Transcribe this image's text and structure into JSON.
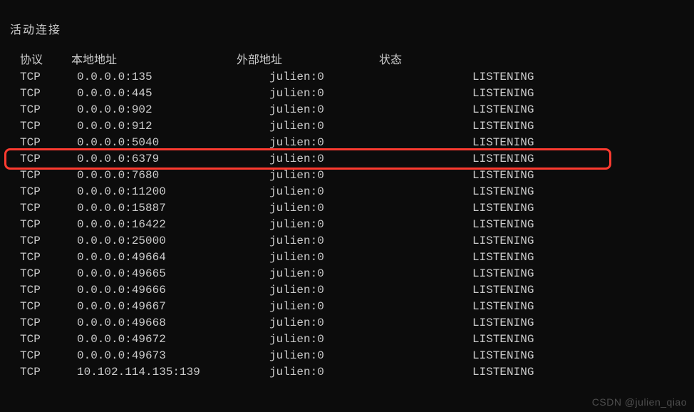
{
  "title": "活动连接",
  "headers": {
    "proto": "协议",
    "local": "本地地址",
    "foreign": "外部地址",
    "state": "状态"
  },
  "rows": [
    {
      "proto": "TCP",
      "local": "0.0.0.0:135",
      "foreign": "julien:0",
      "state": "LISTENING"
    },
    {
      "proto": "TCP",
      "local": "0.0.0.0:445",
      "foreign": "julien:0",
      "state": "LISTENING"
    },
    {
      "proto": "TCP",
      "local": "0.0.0.0:902",
      "foreign": "julien:0",
      "state": "LISTENING"
    },
    {
      "proto": "TCP",
      "local": "0.0.0.0:912",
      "foreign": "julien:0",
      "state": "LISTENING"
    },
    {
      "proto": "TCP",
      "local": "0.0.0.0:5040",
      "foreign": "julien:0",
      "state": "LISTENING"
    },
    {
      "proto": "TCP",
      "local": "0.0.0.0:6379",
      "foreign": "julien:0",
      "state": "LISTENING"
    },
    {
      "proto": "TCP",
      "local": "0.0.0.0:7680",
      "foreign": "julien:0",
      "state": "LISTENING"
    },
    {
      "proto": "TCP",
      "local": "0.0.0.0:11200",
      "foreign": "julien:0",
      "state": "LISTENING"
    },
    {
      "proto": "TCP",
      "local": "0.0.0.0:15887",
      "foreign": "julien:0",
      "state": "LISTENING"
    },
    {
      "proto": "TCP",
      "local": "0.0.0.0:16422",
      "foreign": "julien:0",
      "state": "LISTENING"
    },
    {
      "proto": "TCP",
      "local": "0.0.0.0:25000",
      "foreign": "julien:0",
      "state": "LISTENING"
    },
    {
      "proto": "TCP",
      "local": "0.0.0.0:49664",
      "foreign": "julien:0",
      "state": "LISTENING"
    },
    {
      "proto": "TCP",
      "local": "0.0.0.0:49665",
      "foreign": "julien:0",
      "state": "LISTENING"
    },
    {
      "proto": "TCP",
      "local": "0.0.0.0:49666",
      "foreign": "julien:0",
      "state": "LISTENING"
    },
    {
      "proto": "TCP",
      "local": "0.0.0.0:49667",
      "foreign": "julien:0",
      "state": "LISTENING"
    },
    {
      "proto": "TCP",
      "local": "0.0.0.0:49668",
      "foreign": "julien:0",
      "state": "LISTENING"
    },
    {
      "proto": "TCP",
      "local": "0.0.0.0:49672",
      "foreign": "julien:0",
      "state": "LISTENING"
    },
    {
      "proto": "TCP",
      "local": "0.0.0.0:49673",
      "foreign": "julien:0",
      "state": "LISTENING"
    },
    {
      "proto": "TCP",
      "local": "10.102.114.135:139",
      "foreign": "julien:0",
      "state": "LISTENING"
    }
  ],
  "highlight_row_index": 5,
  "watermark": "CSDN @julien_qiao"
}
